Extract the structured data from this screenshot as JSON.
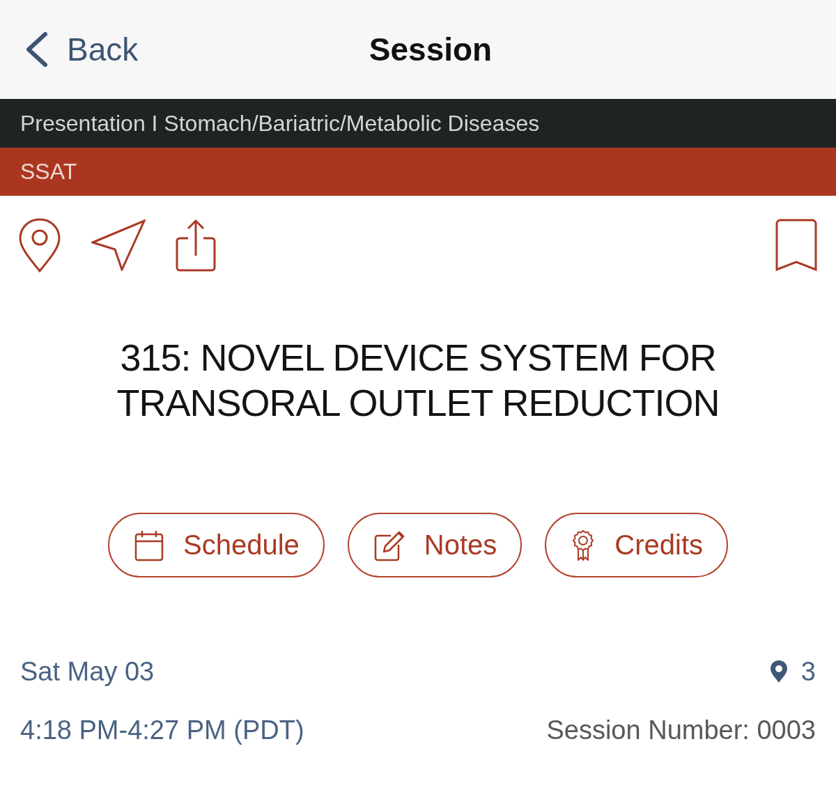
{
  "nav": {
    "back": "Back",
    "title": "Session"
  },
  "category_bar": {
    "text": "Presentation I Stomach/Bariatric/Metabolic Diseases"
  },
  "society_bar": {
    "text": "SSAT"
  },
  "toolbar": {
    "bookmarked": false
  },
  "title": "315: NOVEL DEVICE SYSTEM FOR TRANSORAL OUTLET REDUCTION",
  "buttons": [
    {
      "kind": "schedule",
      "label": "Schedule"
    },
    {
      "kind": "notes",
      "label": "Notes"
    },
    {
      "kind": "credits",
      "label": "Credits"
    }
  ],
  "details": {
    "date": "Sat May 03",
    "room": "3",
    "time": "4:18 PM-4:27 PM (PDT)",
    "session_number": "Session Number: 0003"
  }
}
